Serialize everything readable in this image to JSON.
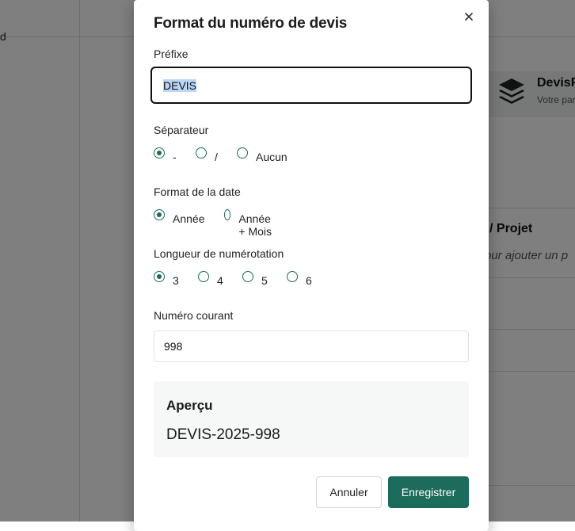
{
  "background": {
    "left_text": "d",
    "brand_name": "DevisP",
    "brand_sub": "Votre par",
    "section_title": "/ Projet",
    "section_hint": "our ajouter un p"
  },
  "modal": {
    "title": "Format du numéro de devis",
    "close_icon": "close-icon",
    "prefix": {
      "label": "Préfixe",
      "value": "DEVIS"
    },
    "separator": {
      "label": "Séparateur",
      "options": [
        "-",
        "/",
        "Aucun"
      ],
      "selected": "-"
    },
    "date_format": {
      "label": "Format de la date",
      "options": [
        "Année",
        "Année + Mois"
      ],
      "selected": "Année"
    },
    "length": {
      "label": "Longueur de numérotation",
      "options": [
        "3",
        "4",
        "5",
        "6"
      ],
      "selected": "3"
    },
    "current_number": {
      "label": "Numéro courant",
      "value": "998"
    },
    "preview": {
      "title": "Aperçu",
      "value": "DEVIS-2025-998"
    },
    "cancel_label": "Annuler",
    "save_label": "Enregistrer"
  },
  "colors": {
    "accent": "#1d6b5a",
    "overlay": "rgba(0,0,0,0.5)"
  }
}
